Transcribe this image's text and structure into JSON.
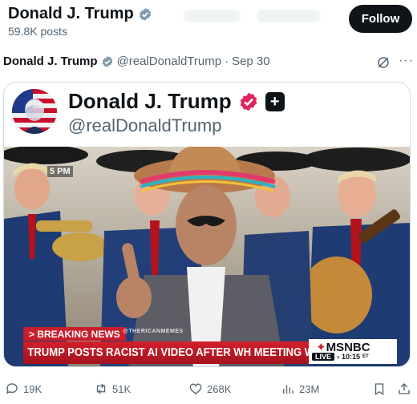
{
  "profile": {
    "name": "Donald J. Trump",
    "posts_count": "59.8K posts",
    "follow_label": "Follow"
  },
  "post": {
    "author": "Donald J. Trump",
    "handle": "@realDonaldTrump",
    "separator": "·",
    "date": "Sep 30",
    "more_glyph": "···"
  },
  "embed": {
    "name": "Donald J. Trump",
    "handle": "@realDonaldTrump",
    "plus_glyph": "+"
  },
  "video": {
    "corner_time": "5 PM",
    "breaking_label": "> BREAKING NEWS",
    "watermark": "@THERICANMEMES",
    "chyron": "TRUMP POSTS RACIST AI VIDEO AFTER WH MEETING W/ DEMS",
    "network": "MSNBC",
    "live_label": "LIVE",
    "live_arrow": "›",
    "live_time": "10:15",
    "live_zone": "ET"
  },
  "actions": {
    "replies": "19K",
    "reposts": "51K",
    "likes": "268K",
    "views": "23M"
  },
  "colors": {
    "verified_blue": "#1d9bf0",
    "verified_pink": "#e0245e",
    "text_secondary": "#536471",
    "chyron_red": "#c81e2b"
  },
  "icons": [
    "verified-badge-icon",
    "grok-icon",
    "more-icon",
    "plus-icon",
    "reply-icon",
    "repost-icon",
    "like-icon",
    "views-icon",
    "bookmark-icon",
    "share-icon"
  ]
}
